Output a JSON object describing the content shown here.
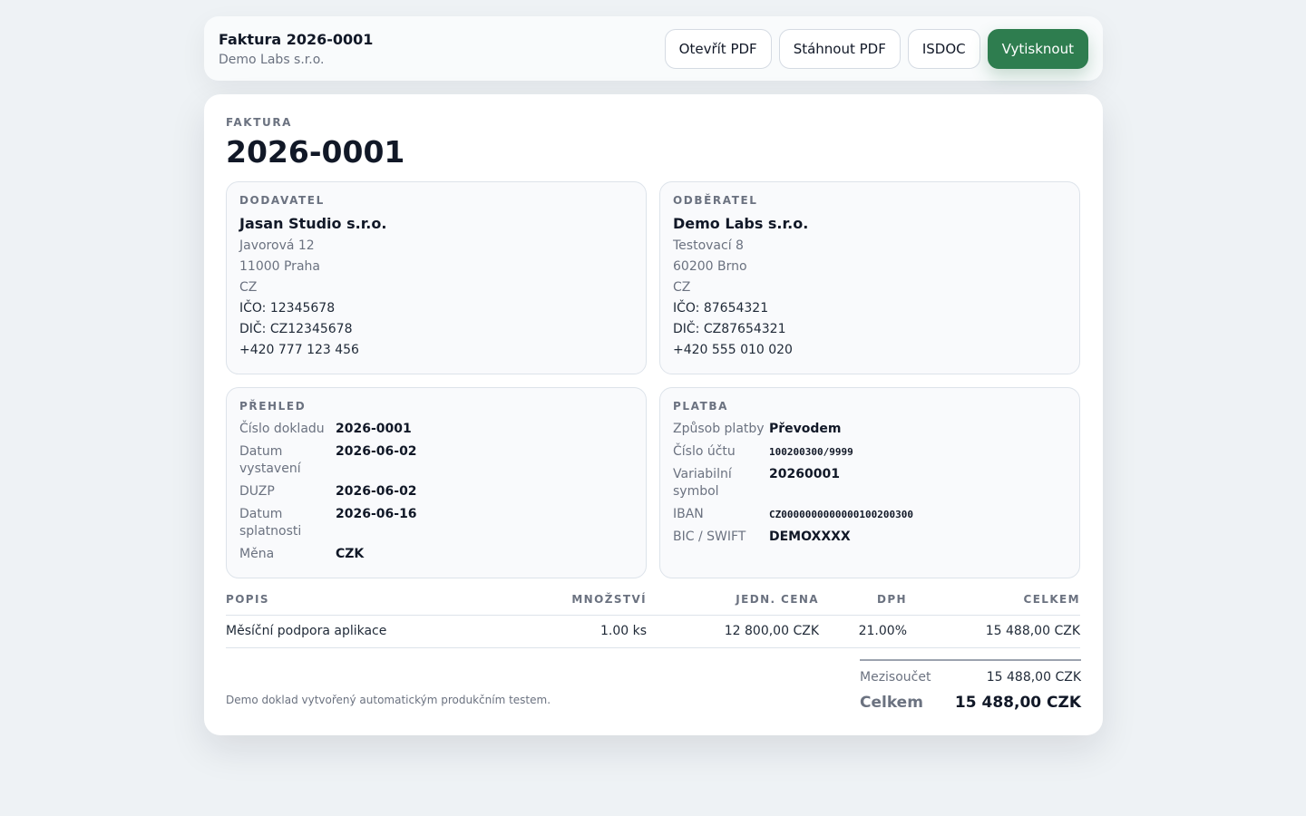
{
  "header": {
    "title": "Faktura 2026-0001",
    "company": "Demo Labs s.r.o.",
    "buttons": {
      "open_pdf": "Otevřít PDF",
      "download_pdf": "Stáhnout PDF",
      "isdoc": "ISDOC",
      "print": "Vytisknout"
    }
  },
  "invoice": {
    "kicker": "FAKTURA",
    "number": "2026-0001"
  },
  "supplier": {
    "label": "DODAVATEL",
    "name": "Jasan Studio s.r.o.",
    "street": "Javorová 12",
    "city": "11000 Praha",
    "country": "CZ",
    "ico": "IČO: 12345678",
    "dic": "DIČ: CZ12345678",
    "phone": "+420 777 123 456"
  },
  "customer": {
    "label": "ODBĚRATEL",
    "name": "Demo Labs s.r.o.",
    "street": "Testovací 8",
    "city": "60200 Brno",
    "country": "CZ",
    "ico": "IČO: 87654321",
    "dic": "DIČ: CZ87654321",
    "phone": "+420 555 010 020"
  },
  "overview": {
    "label": "PŘEHLED",
    "rows": [
      {
        "k": "Číslo dokladu",
        "v": "2026-0001"
      },
      {
        "k": "Datum vystavení",
        "v": "2026-06-02"
      },
      {
        "k": "DUZP",
        "v": "2026-06-02"
      },
      {
        "k": "Datum splatnosti",
        "v": "2026-06-16"
      },
      {
        "k": "Měna",
        "v": "CZK"
      }
    ]
  },
  "payment": {
    "label": "PLATBA",
    "rows": [
      {
        "k": "Způsob platby",
        "v": "Převodem"
      },
      {
        "k": "Číslo účtu",
        "v": "100200300/9999"
      },
      {
        "k": "Variabilní symbol",
        "v": "20260001"
      },
      {
        "k": "IBAN",
        "v": "CZ0000000000000100200300"
      },
      {
        "k": "BIC / SWIFT",
        "v": "DEMOXXXX"
      }
    ]
  },
  "items": {
    "headers": {
      "description": "POPIS",
      "quantity": "MNOŽSTVÍ",
      "unit_price": "JEDN. CENA",
      "vat": "DPH",
      "total": "CELKEM"
    },
    "rows": [
      {
        "description": "Měsíční podpora aplikace",
        "quantity": "1.00 ks",
        "unit_price": "12 800,00 CZK",
        "vat": "21.00%",
        "total": "15 488,00 CZK"
      }
    ]
  },
  "footer": {
    "note": "Demo doklad vytvořený automatickým produkčním testem.",
    "subtotal_label": "Mezisoučet",
    "subtotal_value": "15 488,00 CZK",
    "total_label": "Celkem",
    "total_value": "15 488,00 CZK"
  },
  "colors": {
    "accent": "#2e7d4f",
    "background": "#eef2f5"
  }
}
